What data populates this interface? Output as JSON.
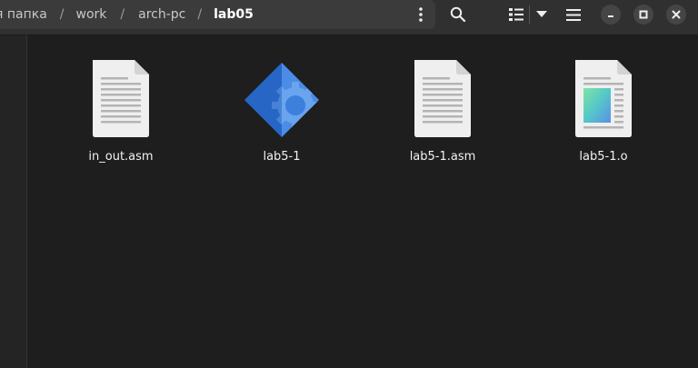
{
  "breadcrumbs": [
    {
      "label": "я папка"
    },
    {
      "label": "work"
    },
    {
      "label": "arch-pc"
    },
    {
      "label": "lab05"
    }
  ],
  "separator": "/",
  "toolbar": {
    "menu_icon": "vertical-ellipsis-icon",
    "search_icon": "search-icon",
    "view_icon": "list-view-icon",
    "view_dropdown_icon": "triangle-down-icon",
    "main_menu_icon": "hamburger-icon",
    "minimize_icon": "minimize-icon",
    "maximize_icon": "maximize-icon",
    "close_icon": "close-icon"
  },
  "files": [
    {
      "name": "in_out.asm",
      "icon": "text-document-icon"
    },
    {
      "name": "lab5-1",
      "icon": "executable-gear-icon"
    },
    {
      "name": "lab5-1.asm",
      "icon": "text-document-icon"
    },
    {
      "name": "lab5-1.o",
      "icon": "object-file-icon"
    }
  ],
  "colors": {
    "background": "#1e1e1e",
    "header": "#303030",
    "pathbar": "#3b3b3b",
    "executable_blue": "#3a78d8"
  }
}
